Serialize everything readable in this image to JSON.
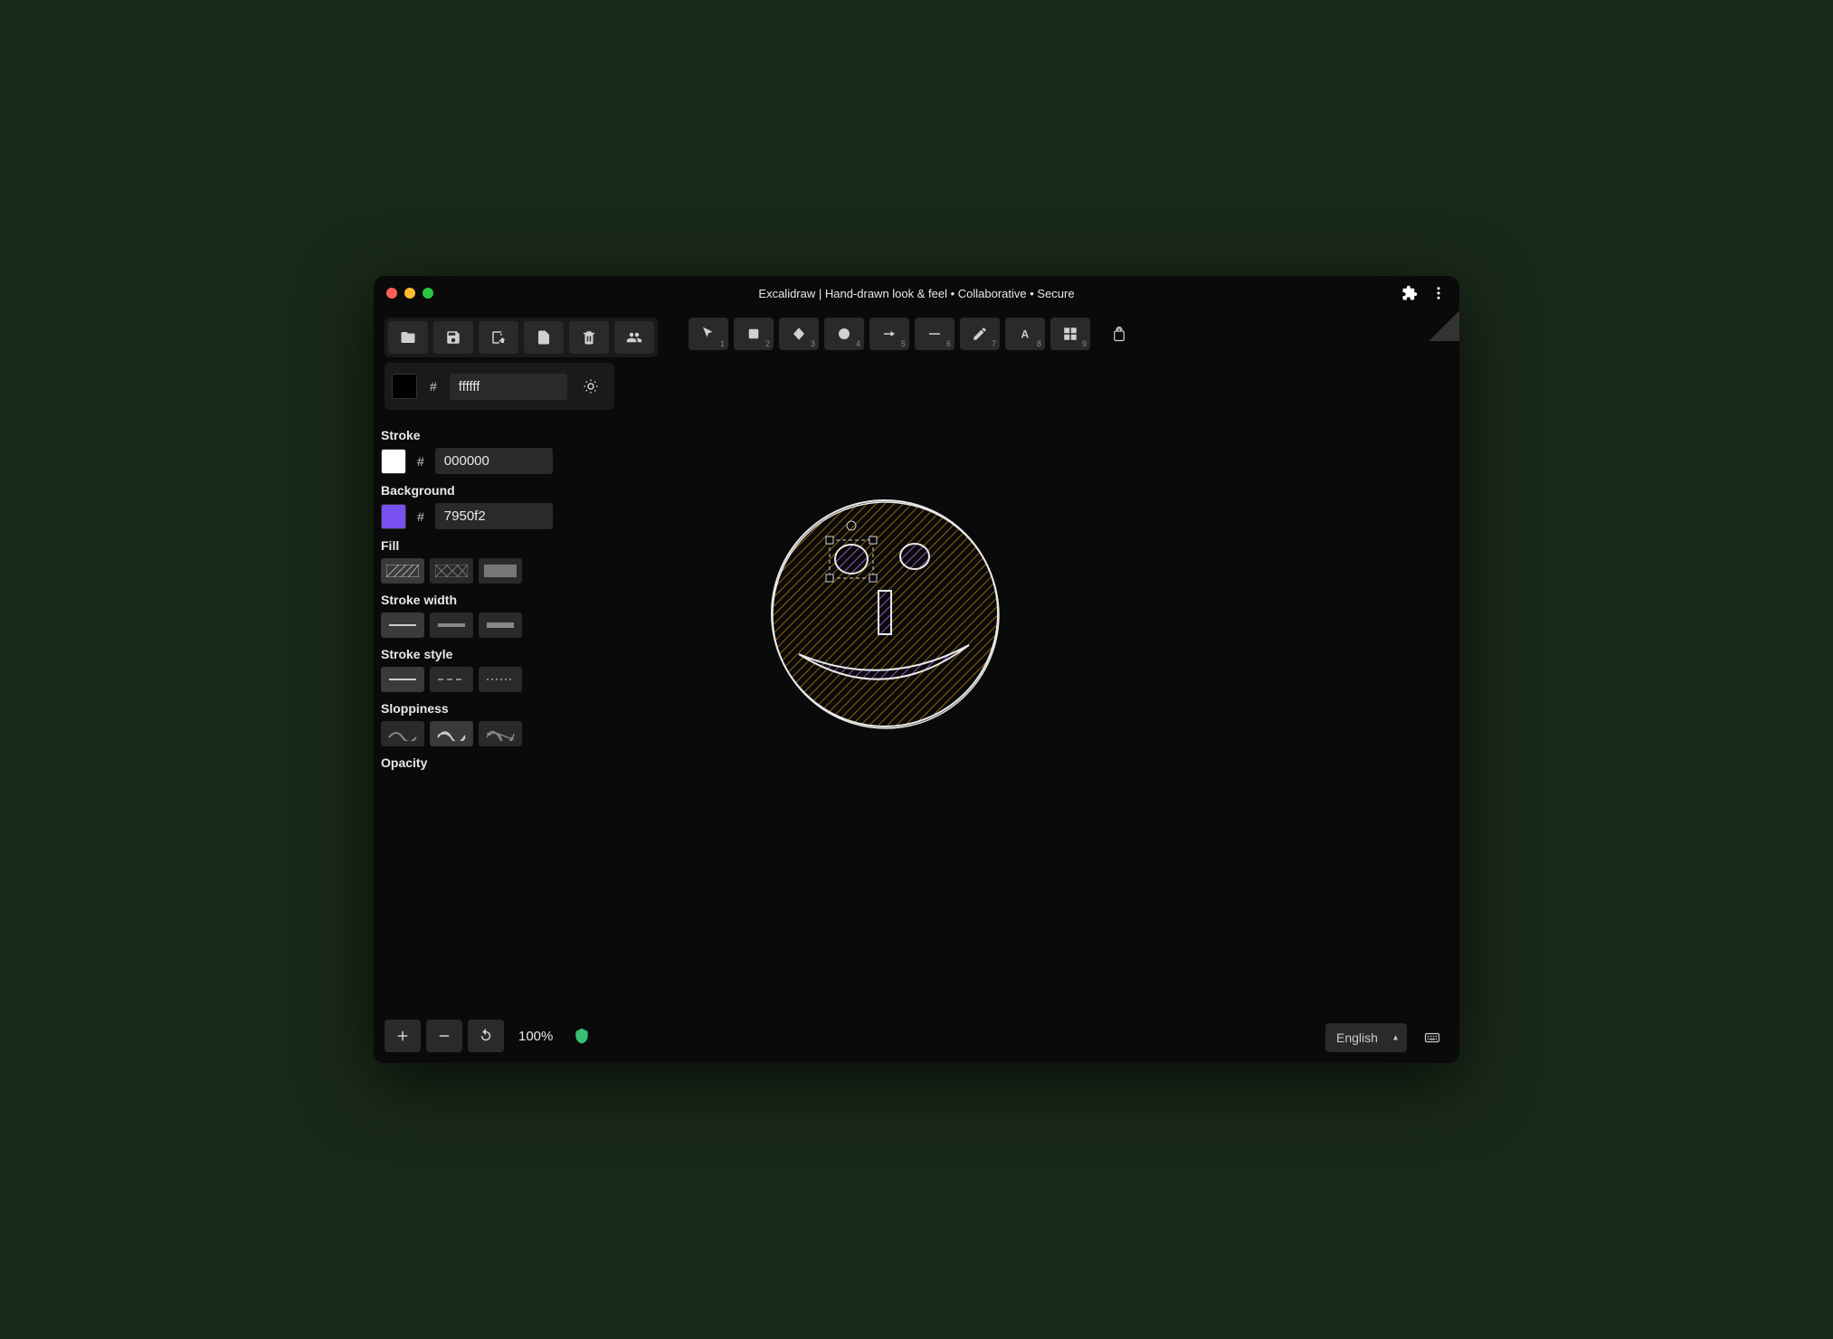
{
  "window": {
    "title": "Excalidraw | Hand-drawn look & feel • Collaborative • Secure"
  },
  "canvas_bg": {
    "hash": "#",
    "value": "ffffff"
  },
  "props": {
    "stroke_label": "Stroke",
    "stroke_hash": "#",
    "stroke_value": "000000",
    "background_label": "Background",
    "background_hash": "#",
    "background_value": "7950f2",
    "fill_label": "Fill",
    "stroke_width_label": "Stroke width",
    "stroke_style_label": "Stroke style",
    "sloppiness_label": "Sloppiness",
    "opacity_label": "Opacity"
  },
  "tools": {
    "numbers": [
      "1",
      "2",
      "3",
      "4",
      "5",
      "6",
      "7",
      "8",
      "9"
    ]
  },
  "colors": {
    "stroke_swatch": "#ffffff",
    "bg_swatch": "#7950f2"
  },
  "zoom": {
    "level": "100%"
  },
  "language": {
    "selected": "English"
  }
}
